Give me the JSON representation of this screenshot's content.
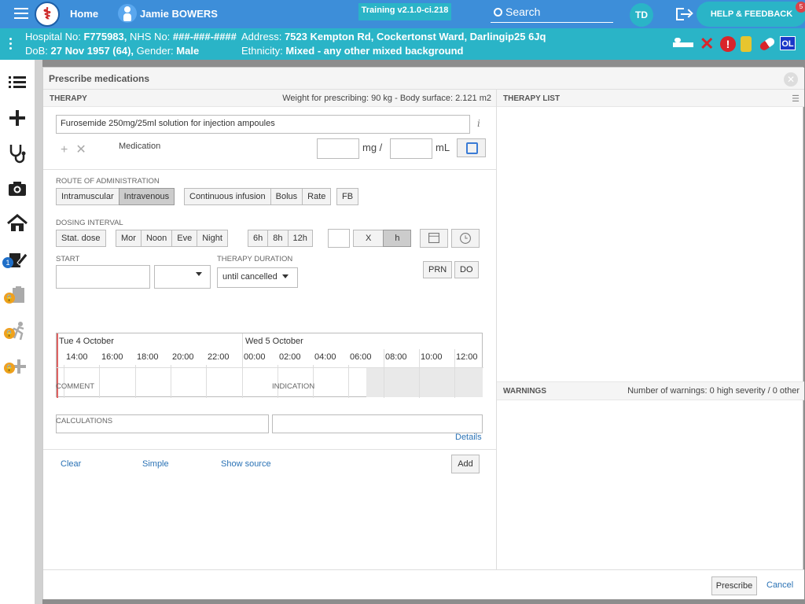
{
  "topbar": {
    "home": "Home",
    "patient_name": "Jamie BOWERS",
    "build": "Training v2.1.0-ci.218",
    "search": "Search",
    "user_initials": "TD",
    "help": "HELP & FEEDBACK",
    "help_count": "5"
  },
  "patient": {
    "hospital_label": "Hospital No:",
    "hospital_no": "F775983,",
    "nhs_label": "NHS No:",
    "nhs_no": "###-###-####",
    "dob_label": "DoB:",
    "dob": "27 Nov 1957 (64),",
    "gender_label": "Gender:",
    "gender": "Male",
    "address_label": "Address:",
    "address": "7523 Kempton Rd, Cockertonst Ward, Darlingip25 6Jq",
    "ethnicity_label": "Ethnicity:",
    "ethnicity": "Mixed - any other mixed background",
    "ol": "OL",
    "excl": "!"
  },
  "sidebar": {
    "badge_count": "1"
  },
  "modal": {
    "title": "Prescribe medications",
    "therapy_header": "THERAPY",
    "weight_info": "Weight for prescribing: 90 kg - Body surface: 2.121 m2",
    "medication_value": "Furosemide 250mg/25ml solution for injection ampoules",
    "medication_label": "Medication",
    "unit_mg": "mg /",
    "unit_ml": "mL",
    "route_label": "ROUTE OF ADMINISTRATION",
    "routes": [
      "Intramuscular",
      "Intravenous"
    ],
    "infusion": [
      "Continuous infusion",
      "Bolus",
      "Rate"
    ],
    "fb": "FB",
    "dosing_label": "DOSING INTERVAL",
    "stat": "Stat. dose",
    "times": [
      "Mor",
      "Noon",
      "Eve",
      "Night"
    ],
    "hours": [
      "6h",
      "8h",
      "12h"
    ],
    "x": "X",
    "h": "h",
    "start_label": "START",
    "duration_label": "THERAPY DURATION",
    "duration_value": "until cancelled",
    "prn": "PRN",
    "do": "DO",
    "day1": "Tue 4 October",
    "day2": "Wed 5 October",
    "hour_ticks": [
      "14:00",
      "16:00",
      "18:00",
      "20:00",
      "22:00",
      "00:00",
      "02:00",
      "04:00",
      "06:00",
      "08:00",
      "10:00",
      "12:00"
    ],
    "comment_label": "COMMENT",
    "indication_label": "INDICATION",
    "calculations_label": "CALCULATIONS",
    "details": "Details",
    "clear": "Clear",
    "simple": "Simple",
    "show_source": "Show source",
    "add": "Add",
    "therapy_list_header": "THERAPY LIST",
    "warnings_header": "WARNINGS",
    "warnings_info": "Number of warnings: 0 high severity / 0 other",
    "prescribe": "Prescribe",
    "cancel": "Cancel"
  }
}
